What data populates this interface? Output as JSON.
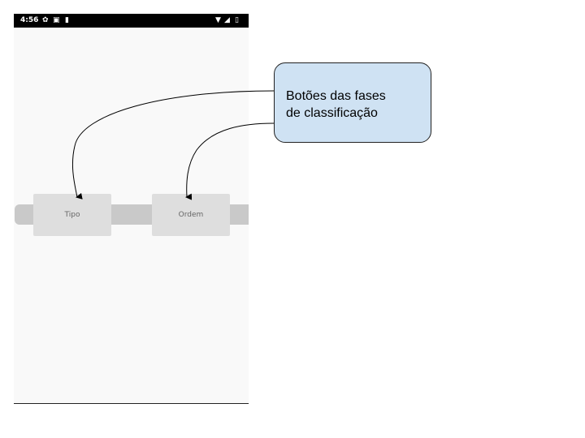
{
  "status_bar": {
    "time": "4:56",
    "left_icons": [
      "settings-icon",
      "media-icon",
      "sd-card-icon"
    ],
    "right_icons": [
      "wifi-icon",
      "signal-icon",
      "battery-icon"
    ]
  },
  "phases": [
    {
      "label": "Tipo"
    },
    {
      "label": "Ordem"
    }
  ],
  "callout": {
    "line1": "Botões das fases",
    "line2": "de classificação"
  },
  "colors": {
    "status_bar": "#000000",
    "screen_bg": "#f9f9f9",
    "track": "#c9c9c9",
    "button": "#dedede",
    "callout_bg": "#cfe2f3"
  }
}
